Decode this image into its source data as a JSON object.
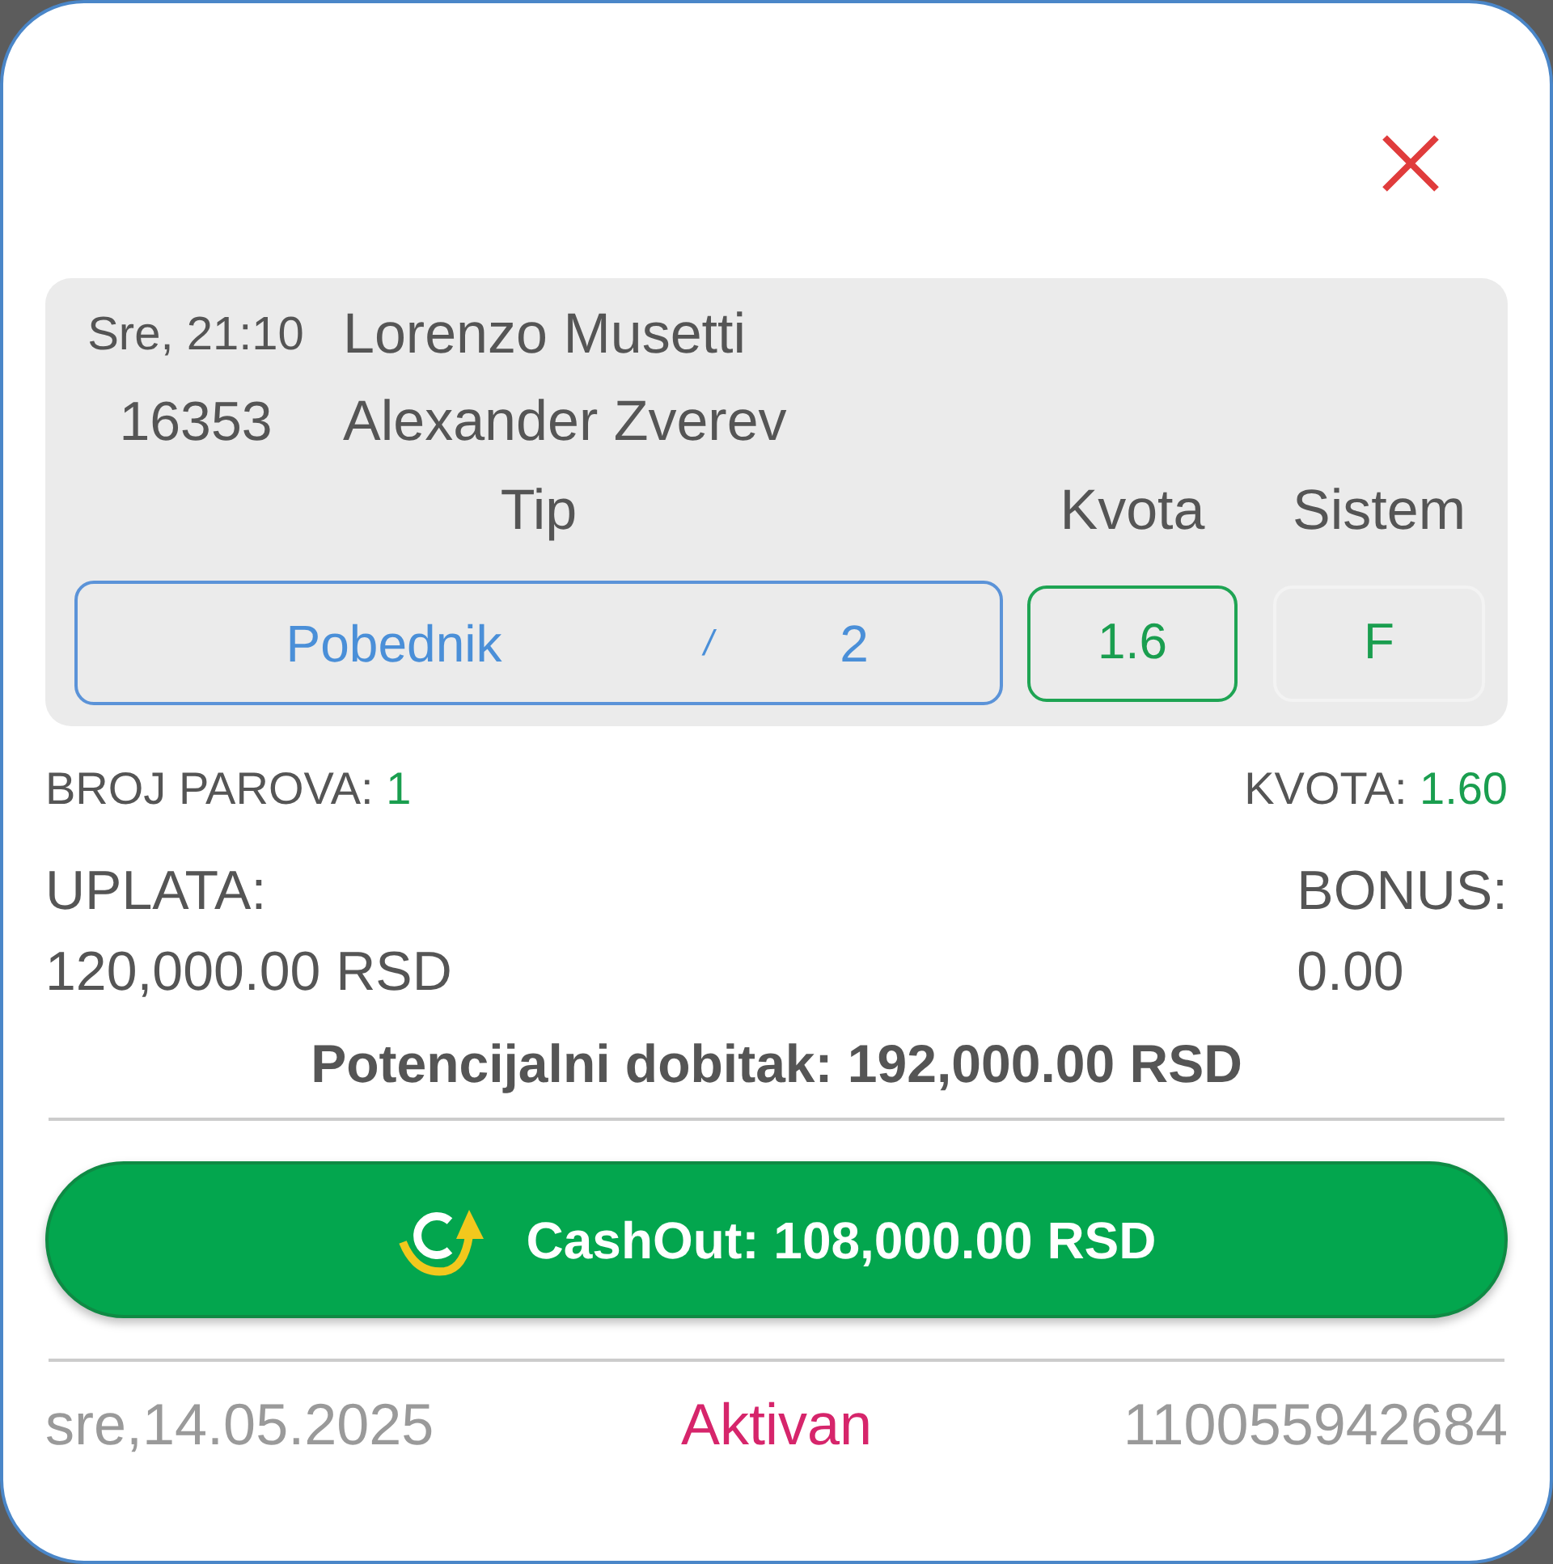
{
  "match": {
    "time": "Sre, 21:10",
    "code": "16353",
    "teams": [
      "Lorenzo Musetti",
      "Alexander Zverev"
    ]
  },
  "columns": [
    {
      "kind": "tip",
      "header": "Tip",
      "market": "Pobednik",
      "separator": "/",
      "pick": "2"
    },
    {
      "kind": "odds",
      "header": "Kvota",
      "value": "1.6"
    },
    {
      "kind": "system",
      "header": "Sistem",
      "value": "F"
    }
  ],
  "summary": {
    "pairs_label": "BROJ PAROVA:",
    "pairs": "1",
    "odds_label": "KVOTA:",
    "odds": "1.60",
    "stake_label": "UPLATA:",
    "stake": "120,000.00 RSD",
    "bonus_label": "BONUS:",
    "bonus": "0.00",
    "potential": "Potencijalni dobitak: 192,000.00 RSD"
  },
  "cashout_button": {
    "label": "CashOut: 108,000.00 RSD"
  },
  "footer": {
    "date": "sre,14.05.2025",
    "status": "Aktivan",
    "ticket_id": "110055942684"
  }
}
